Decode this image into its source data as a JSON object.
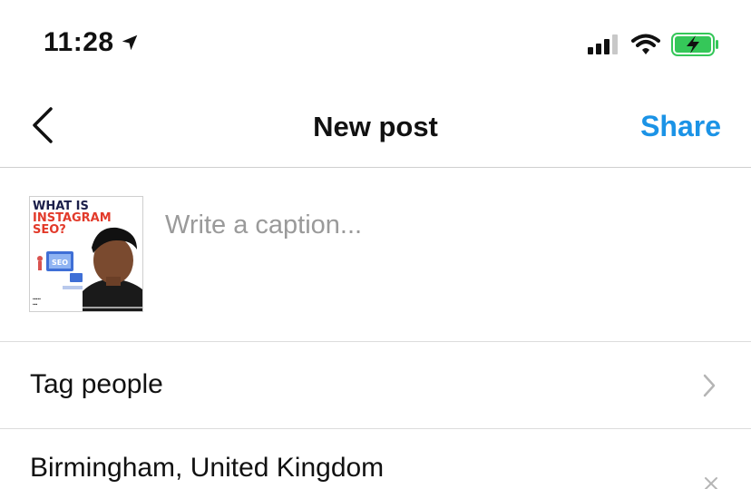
{
  "status_bar": {
    "time": "11:28",
    "icons": [
      "location-arrow-icon",
      "signal-icon",
      "wifi-icon",
      "battery-charging-icon"
    ]
  },
  "nav": {
    "title": "New post",
    "share_label": "Share",
    "back_icon": "chevron-left-icon"
  },
  "caption": {
    "placeholder": "Write a caption...",
    "value": "",
    "thumbnail": {
      "line1": "WHAT IS",
      "line2": "INSTAGRAM",
      "line3": "SEO?",
      "badge": "SEO"
    }
  },
  "rows": {
    "tag_people": "Tag people",
    "location": "Birmingham, United Kingdom"
  },
  "colors": {
    "accent": "#1b93e6",
    "battery_green": "#35c759",
    "thumb_red": "#e23a2a",
    "thumb_navy": "#1b1f4a"
  }
}
